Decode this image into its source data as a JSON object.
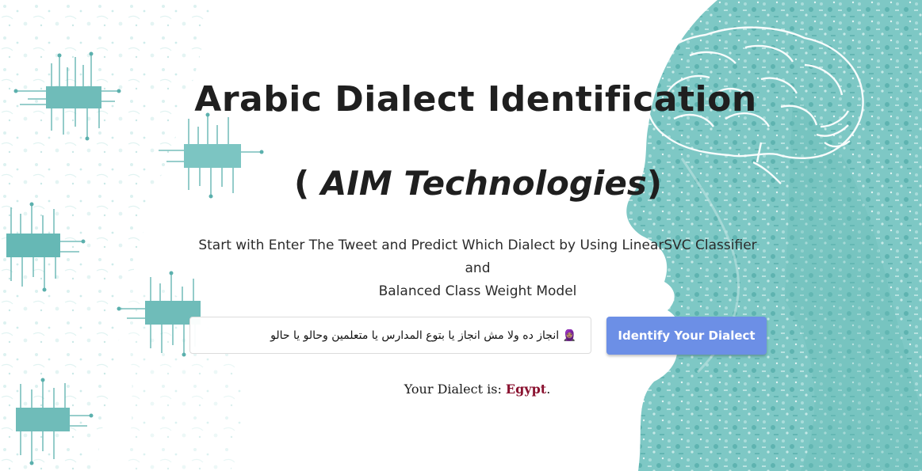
{
  "header": {
    "title": "Arabic Dialect Identification",
    "subtitle_open": "( ",
    "subtitle_brand": "AIM Technologies",
    "subtitle_close": ")"
  },
  "description": {
    "line1": "Start with Enter The Tweet and Predict Which Dialect by Using LinearSVC Classifier and",
    "line2": "Balanced Class Weight Model"
  },
  "form": {
    "tweet_value": "🧕🏽 انجاز ده ولا مش انجاز يا بتوع المدارس يا متعلمين وحالو يا حالو",
    "submit_label": "Identify Your Dialect"
  },
  "result": {
    "label": "Your Dialect is: ",
    "value": "Egypt",
    "suffix": ".",
    "value_color": "#8a1230"
  },
  "colors": {
    "accent_button": "#6c8fe6",
    "teal_art": "#6fc3c1",
    "text_dark": "#1f1f1f"
  },
  "icons": {
    "background_art": "brain-head-silhouette-and-circuit-chips"
  }
}
